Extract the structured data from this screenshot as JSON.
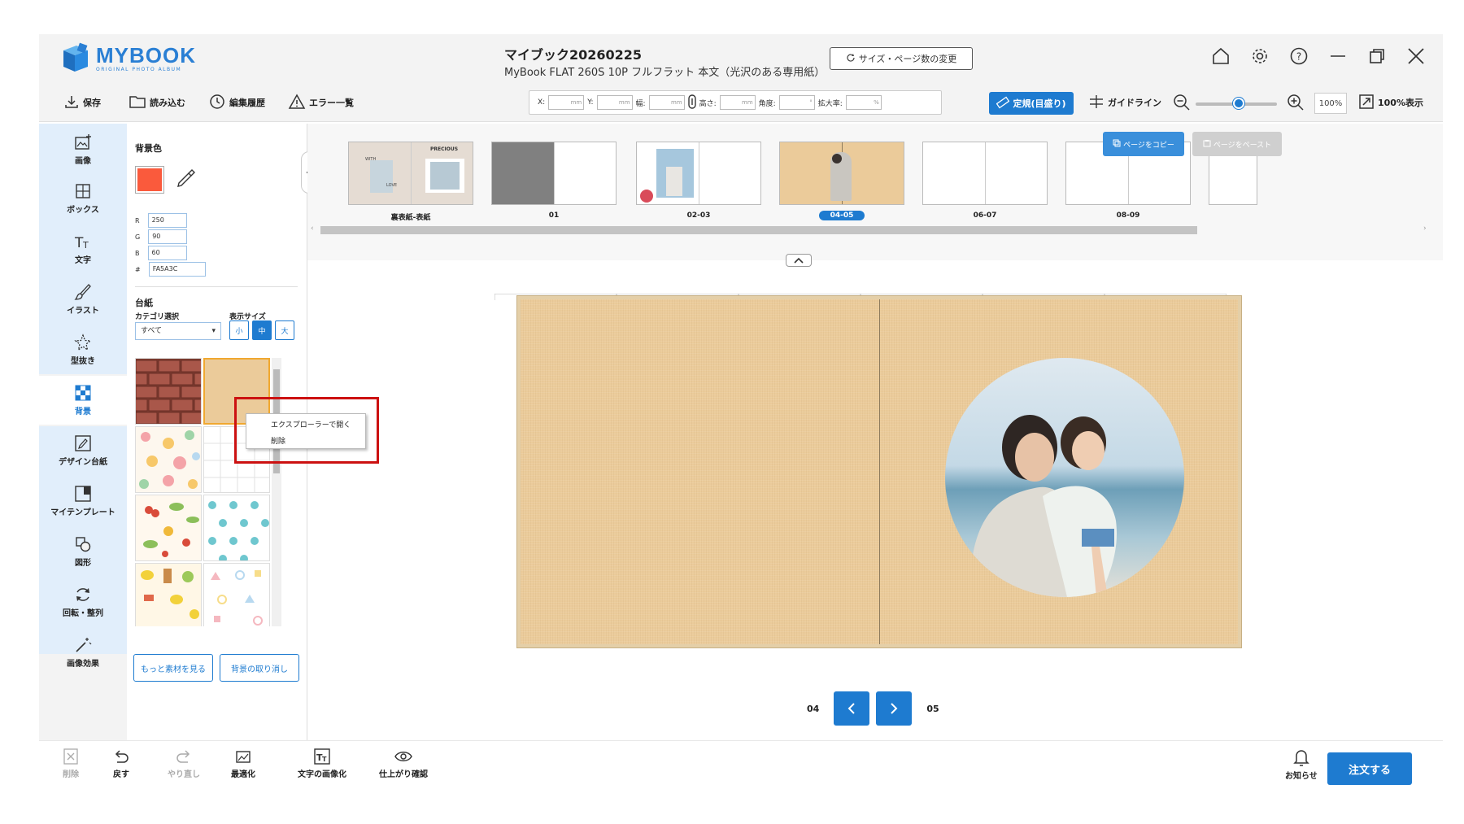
{
  "app": {
    "logo_main": "MYBOOK",
    "logo_sub": "ORIGINAL PHOTO ALBUM",
    "brand_color": "#2a7fd4",
    "accent_color": "#1e7bd0"
  },
  "document": {
    "title": "マイブック20260225",
    "subtitle": "MyBook FLAT 260S 10P フルフラット 本文（光沢のある専用紙）",
    "size_button": "サイズ・ページ数の変更"
  },
  "toolbar": {
    "save": "保存",
    "load": "読み込む",
    "history": "編集履歴",
    "errors": "エラー一覧",
    "fields": [
      {
        "label": "X:",
        "unit": "mm"
      },
      {
        "label": "Y:",
        "unit": "mm"
      },
      {
        "label": "幅:",
        "unit": "mm"
      },
      {
        "label": "高さ:",
        "unit": "mm"
      },
      {
        "label": "角度:",
        "unit": "°"
      },
      {
        "label": "拡大率:",
        "unit": "%"
      }
    ],
    "ruler": "定規(目盛り)",
    "guideline": "ガイドライン",
    "zoom_value": "100%",
    "zoom_fit": "100%表示"
  },
  "nav": [
    {
      "label": "画像",
      "icon": "image-add-icon"
    },
    {
      "label": "ボックス",
      "icon": "box-icon"
    },
    {
      "label": "文字",
      "icon": "text-icon"
    },
    {
      "label": "イラスト",
      "icon": "brush-icon"
    },
    {
      "label": "型抜き",
      "icon": "star-cutout-icon"
    },
    {
      "label": "背景",
      "icon": "checker-icon"
    },
    {
      "label": "デザイン台紙",
      "icon": "design-icon"
    },
    {
      "label": "マイテンプレート",
      "icon": "template-icon"
    },
    {
      "label": "図形",
      "icon": "shape-icon"
    },
    {
      "label": "回転・整列",
      "icon": "rotate-icon"
    },
    {
      "label": "画像効果",
      "icon": "magic-icon"
    }
  ],
  "panel": {
    "bg_color_title": "背景色",
    "color_hex_value": "#FA5A3C",
    "r": {
      "label": "R",
      "value": "250"
    },
    "g": {
      "label": "G",
      "value": "90"
    },
    "b": {
      "label": "B",
      "value": "60"
    },
    "hex": {
      "label": "#",
      "value": "FA5A3C"
    },
    "mount_title": "台紙",
    "category_label": "カテゴリ選択",
    "category_value": "すべて",
    "display_size_label": "表示サイズ",
    "sizes": [
      "小",
      "中",
      "大"
    ],
    "more_button": "もっと素材を見る",
    "undo_bg_button": "背景の取り消し"
  },
  "context_menu": {
    "items": [
      "エクスプローラーで開く",
      "削除"
    ]
  },
  "pages": {
    "spreads": [
      {
        "label": "裏表紙-表紙"
      },
      {
        "label": "01"
      },
      {
        "label": "02-03"
      },
      {
        "label": "04-05",
        "selected": true
      },
      {
        "label": "06-07"
      },
      {
        "label": "08-09"
      }
    ],
    "cover_text_1": "WITH",
    "cover_text_2": "LOVE",
    "cover_text_3": "PRECIOUS",
    "copy_button": "ページをコピー",
    "paste_button": "ページをペースト"
  },
  "pager": {
    "left_page": "04",
    "right_page": "05"
  },
  "bottom": {
    "delete": "削除",
    "undo": "戻す",
    "redo": "やり直し",
    "optimize": "最適化",
    "text_image": "文字の画像化",
    "preview": "仕上がり確認",
    "notice": "お知らせ",
    "order": "注文する"
  }
}
